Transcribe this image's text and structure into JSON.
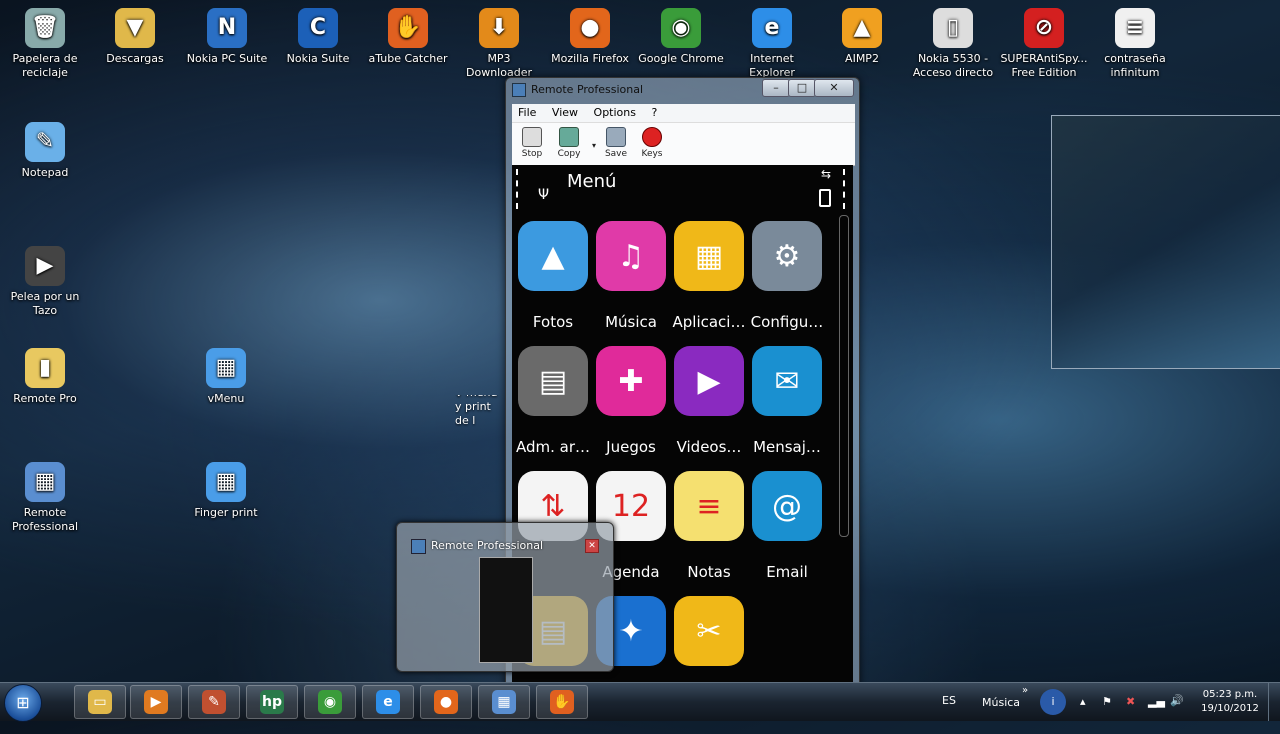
{
  "desktop": {
    "icons_top": [
      {
        "label": "Papelera de reciclaje",
        "glyph": "🗑",
        "color": "#8aa"
      },
      {
        "label": "Descargas",
        "glyph": "▼",
        "color": "#e0b84a"
      },
      {
        "label": "Nokia PC Suite",
        "glyph": "N",
        "color": "#2a6fc4"
      },
      {
        "label": "Nokia Suite",
        "glyph": "C",
        "color": "#1c60b8"
      },
      {
        "label": "aTube Catcher",
        "glyph": "✋",
        "color": "#e06020"
      },
      {
        "label": "MP3 Downloader",
        "glyph": "⬇",
        "color": "#e38a1a"
      },
      {
        "label": "Mozilla Firefox",
        "glyph": "●",
        "color": "#e2661b"
      },
      {
        "label": "Google Chrome",
        "glyph": "◉",
        "color": "#3a9c3a"
      },
      {
        "label": "Internet Explorer",
        "glyph": "e",
        "color": "#2d8ee8"
      },
      {
        "label": "AIMP2",
        "glyph": "▲",
        "color": "#f0a020"
      },
      {
        "label": "Nokia 5530 - Acceso directo",
        "glyph": "▯",
        "color": "#ddd"
      },
      {
        "label": "SUPERAntiSpy... Free Edition",
        "glyph": "⊘",
        "color": "#d42020"
      },
      {
        "label": "contraseña infinitum",
        "glyph": "≡",
        "color": "#f0f0f0"
      }
    ],
    "icons_left": [
      {
        "label": "Notepad",
        "glyph": "✎",
        "color": "#6ab0e8"
      },
      {
        "label": "Pelea por un Tazo",
        "glyph": "▶",
        "color": "#444"
      },
      {
        "label": "Remote Pro",
        "glyph": "▮",
        "color": "#e8c860"
      },
      {
        "label": "Remote Professional",
        "glyph": "▦",
        "color": "#5a8ed0"
      }
    ],
    "icons_mid": [
      {
        "label": "vMenu",
        "glyph": "▦",
        "color": "#4a9de8"
      },
      {
        "label": "Finger print",
        "glyph": "▦",
        "color": "#4a9de8"
      }
    ],
    "partial_label": "V menu y print de l"
  },
  "window": {
    "title": "Remote Professional",
    "menu": [
      "File",
      "View",
      "Options",
      "?"
    ],
    "toolbar": [
      "Stop",
      "Copy",
      "Save",
      "Keys"
    ],
    "phone": {
      "title": "Menú",
      "apps": [
        {
          "label": "Fotos",
          "color": "#3c9ae0",
          "glyph": "▲"
        },
        {
          "label": "Música",
          "color": "#e03aa8",
          "glyph": "♫"
        },
        {
          "label": "Aplicaci…",
          "color": "#f0b818",
          "glyph": "▦"
        },
        {
          "label": "Configu…",
          "color": "#7a8a9a",
          "glyph": "⚙"
        },
        {
          "label": "Adm. ar…",
          "color": "#6a6a6a",
          "glyph": "▤"
        },
        {
          "label": "Juegos",
          "color": "#e02a9a",
          "glyph": "✚"
        },
        {
          "label": "Videos…",
          "color": "#8a2ac0",
          "glyph": "▶"
        },
        {
          "label": "Mensaj…",
          "color": "#1a90d0",
          "glyph": "✉"
        },
        {
          "label": "",
          "color": "#f4f4f4",
          "glyph": "⇅"
        },
        {
          "label": "Agenda",
          "color": "#f4f4f4",
          "glyph": "12"
        },
        {
          "label": "Notas",
          "color": "#f5e070",
          "glyph": "≡"
        },
        {
          "label": "Email",
          "color": "#1a90d0",
          "glyph": "@"
        },
        {
          "label": "",
          "color": "#f0b818",
          "glyph": "▤"
        },
        {
          "label": "",
          "color": "#1a70d0",
          "glyph": "✦"
        },
        {
          "label": "",
          "color": "#f0b818",
          "glyph": "✂"
        }
      ]
    }
  },
  "thumbnail": {
    "title": "Remote Professional"
  },
  "taskbar": {
    "pinned": [
      {
        "name": "explorer",
        "glyph": "▭",
        "color": "#e0b84a"
      },
      {
        "name": "media-player",
        "glyph": "▶",
        "color": "#e07a20"
      },
      {
        "name": "paint",
        "glyph": "✎",
        "color": "#c05030"
      },
      {
        "name": "hp",
        "glyph": "hp",
        "color": "#2a7a4a"
      },
      {
        "name": "chrome",
        "glyph": "◉",
        "color": "#3a9c3a"
      },
      {
        "name": "ie",
        "glyph": "e",
        "color": "#2d8ee8"
      },
      {
        "name": "firefox",
        "glyph": "●",
        "color": "#e2661b"
      },
      {
        "name": "remote",
        "glyph": "▦",
        "color": "#5a8ed0"
      },
      {
        "name": "atube",
        "glyph": "✋",
        "color": "#e06020"
      }
    ],
    "lang": "ES",
    "toolbar_label": "Música",
    "time": "05:23 p.m.",
    "date": "19/10/2012"
  }
}
